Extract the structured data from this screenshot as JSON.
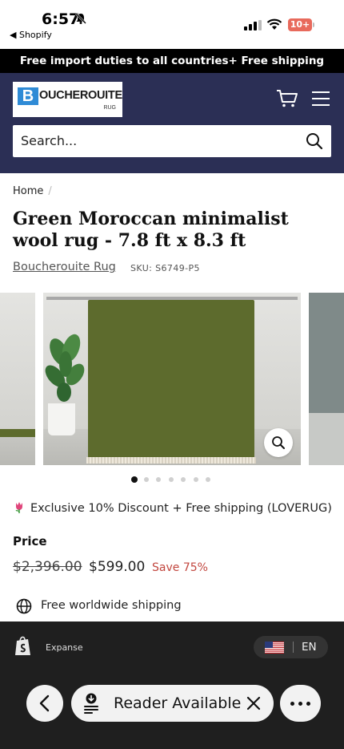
{
  "status_bar": {
    "time": "6:57",
    "back_app": "◀ Shopify",
    "battery": "10+"
  },
  "announcement": {
    "text": "Free import duties to all countries+ Free shipping"
  },
  "header": {
    "logo_letter": "B",
    "logo_text": "OUCHEROUITE",
    "logo_sub": "RUG",
    "search_placeholder": "Search..."
  },
  "breadcrumb": {
    "home": "Home",
    "separator": "/"
  },
  "product": {
    "title": "Green Moroccan minimalist wool rug - 7.8 ft x 8.3 ft",
    "vendor": "Boucherouite Rug",
    "sku": "SKU: S6749-P5",
    "gallery_count": 7,
    "gallery_active": 1
  },
  "promo": {
    "text": "Exclusive 10% Discount + Free shipping (LOVERUG)"
  },
  "price": {
    "label": "Price",
    "compare_at": "$2,396.00",
    "sale": "$599.00",
    "save": "Save 75%"
  },
  "shipping": {
    "text": "Free worldwide shipping"
  },
  "shop_bar": {
    "theme": "Expanse",
    "language": "EN"
  },
  "browser": {
    "reader_label": "Reader Available"
  },
  "colors": {
    "header_bg": "#2b2f55",
    "announcement_bg": "#000000",
    "rug_green": "#5d6b2d",
    "save_red": "#c2473f",
    "logo_blue": "#2f8bd6"
  }
}
